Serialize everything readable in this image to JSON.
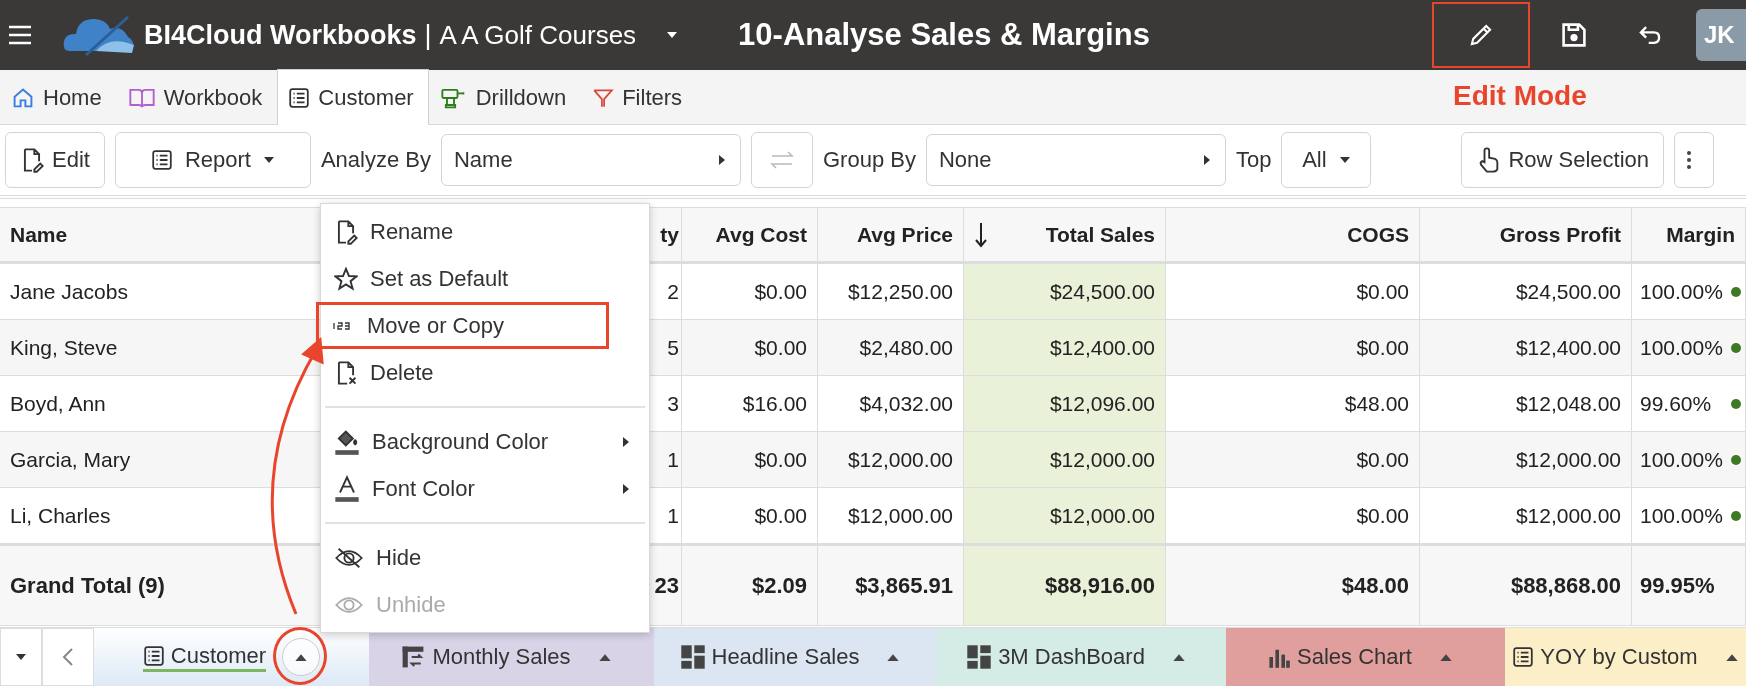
{
  "top_bar": {
    "app_name": "BI4Cloud Workbooks",
    "separator": "|",
    "workbook": "A A Golf Courses",
    "title": "10-Analyse Sales & Margins",
    "actions": [
      {
        "kind": "edit",
        "highlighted": true
      },
      {
        "kind": "save",
        "highlighted": false
      },
      {
        "kind": "undo",
        "highlighted": false
      }
    ],
    "avatar": "JK"
  },
  "annotation": {
    "label": "Edit Mode"
  },
  "ribbon_tabs": [
    {
      "label": "Home",
      "kind": "home",
      "selected": false
    },
    {
      "label": "Workbook",
      "kind": "book",
      "selected": false
    },
    {
      "label": "Customer",
      "kind": "list",
      "selected": true
    },
    {
      "label": "Drilldown",
      "kind": "drill",
      "selected": false
    },
    {
      "label": "Filters",
      "kind": "filter",
      "selected": false
    }
  ],
  "toolbar": {
    "edit": "Edit",
    "report": "Report",
    "analyze_by": {
      "label": "Analyze By",
      "value": "Name"
    },
    "swap_disabled": true,
    "group_by": {
      "label": "Group By",
      "value": "None"
    },
    "top": {
      "label": "Top",
      "value": "All"
    },
    "row_selection": "Row Selection"
  },
  "table": {
    "columns": [
      {
        "label": "Name",
        "sorted": false
      },
      {
        "label": "ty",
        "sorted": false
      },
      {
        "label": "Avg Cost",
        "sorted": false
      },
      {
        "label": "Avg Price",
        "sorted": false
      },
      {
        "label": "Total Sales",
        "sorted": true
      },
      {
        "label": "COGS",
        "sorted": false
      },
      {
        "label": "Gross Profit",
        "sorted": false
      },
      {
        "label": "Margin",
        "sorted": false
      }
    ],
    "rows": [
      [
        "Jane Jacobs",
        "2",
        "$0.00",
        "$12,250.00",
        "$24,500.00",
        "$0.00",
        "$24,500.00",
        "100.00%"
      ],
      [
        "King, Steve",
        "5",
        "$0.00",
        "$2,480.00",
        "$12,400.00",
        "$0.00",
        "$12,400.00",
        "100.00%"
      ],
      [
        "Boyd, Ann",
        "3",
        "$16.00",
        "$4,032.00",
        "$12,096.00",
        "$48.00",
        "$12,048.00",
        "99.60%"
      ],
      [
        "Garcia, Mary",
        "1",
        "$0.00",
        "$12,000.00",
        "$12,000.00",
        "$0.00",
        "$12,000.00",
        "100.00%"
      ],
      [
        "Li, Charles",
        "1",
        "$0.00",
        "$12,000.00",
        "$12,000.00",
        "$0.00",
        "$12,000.00",
        "100.00%"
      ]
    ],
    "total": [
      "Grand Total (9)",
      "23",
      "$2.09",
      "$3,865.91",
      "$88,916.00",
      "$48.00",
      "$88,868.00",
      "99.95%"
    ]
  },
  "context_menu": [
    {
      "kind": "rename",
      "label": "Rename",
      "highlighted": false,
      "disabled": false,
      "submenu": false
    },
    {
      "kind": "default",
      "label": "Set as Default",
      "highlighted": false,
      "disabled": false,
      "submenu": false
    },
    {
      "kind": "move",
      "label": "Move or Copy",
      "highlighted": true,
      "disabled": false,
      "submenu": false
    },
    {
      "kind": "delete",
      "label": "Delete",
      "highlighted": false,
      "disabled": false,
      "submenu": false
    },
    {
      "kind": "separator"
    },
    {
      "kind": "background",
      "label": "Background Color",
      "highlighted": false,
      "disabled": false,
      "submenu": true
    },
    {
      "kind": "font",
      "label": "Font Color",
      "highlighted": false,
      "disabled": false,
      "submenu": true
    },
    {
      "kind": "separator"
    },
    {
      "kind": "hide",
      "label": "Hide",
      "highlighted": false,
      "disabled": false,
      "submenu": false
    },
    {
      "kind": "unhide",
      "label": "Unhide",
      "highlighted": false,
      "disabled": true,
      "submenu": false
    }
  ],
  "sheet_tabs": [
    {
      "label": "Customer",
      "kind": "list",
      "color": "#dde9f6",
      "selected": true,
      "highlighted": true
    },
    {
      "label": "Monthly Sales",
      "kind": "pivot",
      "color": "#d9d3e8",
      "selected": false,
      "highlighted": false
    },
    {
      "label": "Headline Sales",
      "kind": "dashboard",
      "color": "#dce6f2",
      "selected": false,
      "highlighted": false
    },
    {
      "label": "3M DashBoard",
      "kind": "dashboard",
      "color": "#d5ebe5",
      "selected": false,
      "highlighted": false
    },
    {
      "label": "Sales Chart",
      "kind": "chart",
      "color": "#e09f9c",
      "selected": false,
      "highlighted": false
    },
    {
      "label": "YOY by Custom",
      "kind": "list",
      "color": "#fcefc8",
      "selected": false,
      "highlighted": false
    }
  ]
}
